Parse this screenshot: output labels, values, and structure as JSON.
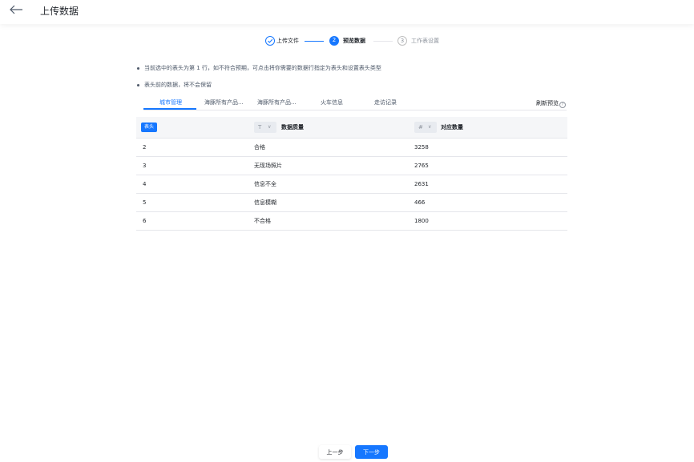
{
  "header": {
    "title": "上传数据",
    "back_icon": "arrow-left-icon"
  },
  "steps": [
    {
      "index": "1",
      "label": "上传文件",
      "status": "done"
    },
    {
      "index": "2",
      "label": "预览数据",
      "status": "active"
    },
    {
      "index": "3",
      "label": "工作表设置",
      "status": "pending"
    }
  ],
  "notes": [
    "当前选中的表头为第 1 行，如不符合预期，可点击将你需要的数据行指定为表头和设置表头类型",
    "表头前的数据，将不会保留"
  ],
  "tabs": [
    {
      "label": "城市管理",
      "active": true
    },
    {
      "label": "海豚所有产品...",
      "active": false
    },
    {
      "label": "海豚所有产品...",
      "active": false
    },
    {
      "label": "火车信息",
      "active": false
    },
    {
      "label": "走访记录",
      "active": false
    }
  ],
  "refresh_label": "刷新预览",
  "table": {
    "header_badge": "表头",
    "columns": [
      {
        "type_glyph": "T",
        "title": "数据质量"
      },
      {
        "type_glyph": "#",
        "title": "对应数量"
      }
    ],
    "rows": [
      {
        "row": "2",
        "quality": "合格",
        "count": "3258"
      },
      {
        "row": "3",
        "quality": "无现场照片",
        "count": "2765"
      },
      {
        "row": "4",
        "quality": "信息不全",
        "count": "2631"
      },
      {
        "row": "5",
        "quality": "信息模糊",
        "count": "466"
      },
      {
        "row": "6",
        "quality": "不合格",
        "count": "1800"
      }
    ]
  },
  "footer": {
    "prev_label": "上一步",
    "next_label": "下一步"
  },
  "colors": {
    "primary": "#1677ff",
    "border": "#e5e6eb",
    "header_bg": "#f5f6f8"
  }
}
